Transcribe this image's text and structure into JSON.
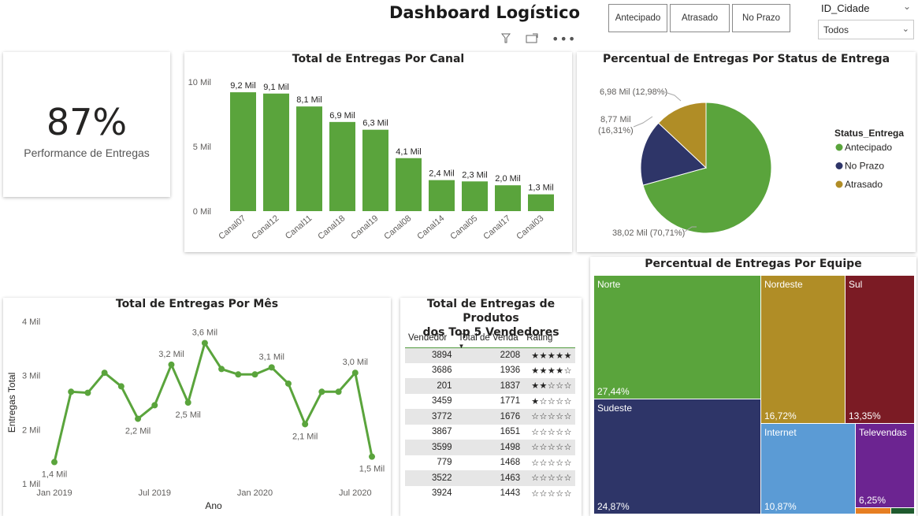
{
  "page": {
    "title": "Dashboard Logístico"
  },
  "filters": {
    "status_buttons": [
      "Antecipado",
      "Atrasado",
      "No Prazo"
    ],
    "id_cidade": {
      "label": "ID_Cidade",
      "value": "Todos"
    }
  },
  "toolbar": {
    "filter_icon": "filter-icon",
    "focus_icon": "focus-mode-icon",
    "more_icon": "more-options-icon"
  },
  "kpi": {
    "value": "87%",
    "label": "Performance de Entregas"
  },
  "colors": {
    "green": "#5aa43c",
    "navy": "#2e3568",
    "gold": "#b08d26",
    "maroon": "#7b1b24",
    "blue": "#5b9bd5",
    "purple": "#6c2491"
  },
  "chart_data": [
    {
      "type": "bar",
      "title": "Total de Entregas Por Canal",
      "categories": [
        "Canal07",
        "Canal12",
        "Canal11",
        "Canal18",
        "Canal19",
        "Canal08",
        "Canal14",
        "Canal05",
        "Canal17",
        "Canal03"
      ],
      "values": [
        9.2,
        9.1,
        8.1,
        6.9,
        6.3,
        4.1,
        2.4,
        2.3,
        2.0,
        1.3
      ],
      "data_labels": [
        "9,2 Mil",
        "9,1 Mil",
        "8,1 Mil",
        "6,9 Mil",
        "6,3 Mil",
        "4,1 Mil",
        "2,4 Mil",
        "2,3 Mil",
        "2,0 Mil",
        "1,3 Mil"
      ],
      "y_ticks": [
        "0 Mil",
        "5 Mil",
        "10 Mil"
      ],
      "ylim": [
        0,
        10
      ],
      "unit": "Mil"
    },
    {
      "type": "pie",
      "title": "Percentual de Entregas Por Status de Entrega",
      "legend_title": "Status_Entrega",
      "legend_position": "right",
      "slices": [
        {
          "name": "Antecipado",
          "value": 38.02,
          "label": "38,02 Mil (70,71%)",
          "color": "#5aa43c"
        },
        {
          "name": "No Prazo",
          "value": 8.77,
          "label_line1": "8,77 Mil",
          "label_line2": "(16,31%)",
          "color": "#2e3568"
        },
        {
          "name": "Atrasado",
          "value": 6.98,
          "label": "6,98 Mil (12,98%)",
          "color": "#b08d26"
        }
      ]
    },
    {
      "type": "line",
      "title": "Total de Entregas Por Mês",
      "xlabel": "Ano",
      "ylabel": "Entregas Total",
      "x_ticks": [
        "Jan 2019",
        "Jul 2019",
        "Jan 2020",
        "Jul 2020"
      ],
      "x_tick_index": [
        0,
        6,
        12,
        18
      ],
      "y_ticks": [
        "1 Mil",
        "2 Mil",
        "3 Mil",
        "4 Mil"
      ],
      "ylim": [
        1,
        4
      ],
      "values": [
        1.4,
        2.7,
        2.68,
        3.05,
        2.8,
        2.2,
        2.45,
        3.2,
        2.5,
        3.6,
        3.12,
        3.02,
        3.02,
        3.15,
        2.85,
        2.1,
        2.7,
        2.7,
        3.05,
        1.5
      ],
      "labeled_points": [
        {
          "i": 0,
          "text": "1,4 Mil",
          "pos": "below"
        },
        {
          "i": 5,
          "text": "2,2 Mil",
          "pos": "below"
        },
        {
          "i": 7,
          "text": "3,2 Mil",
          "pos": "above"
        },
        {
          "i": 8,
          "text": "2,5 Mil",
          "pos": "below"
        },
        {
          "i": 9,
          "text": "3,6 Mil",
          "pos": "above"
        },
        {
          "i": 13,
          "text": "3,1 Mil",
          "pos": "above"
        },
        {
          "i": 15,
          "text": "2,1 Mil",
          "pos": "below"
        },
        {
          "i": 18,
          "text": "3,0 Mil",
          "pos": "above"
        },
        {
          "i": 19,
          "text": "1,5 Mil",
          "pos": "below"
        }
      ]
    },
    {
      "type": "table",
      "title_line1": "Total de Entregas de Produtos",
      "title_line2": "dos Top 5 Vendedores",
      "columns": [
        "Vendedor",
        "Total de Venda",
        "Rating"
      ],
      "sort_column": "Total de Venda",
      "rows": [
        [
          "3894",
          "2208",
          "★★★★★"
        ],
        [
          "3686",
          "1936",
          "★★★★☆"
        ],
        [
          "201",
          "1837",
          "★★☆☆☆"
        ],
        [
          "3459",
          "1771",
          "★☆☆☆☆"
        ],
        [
          "3772",
          "1676",
          "☆☆☆☆☆"
        ],
        [
          "3867",
          "1651",
          "☆☆☆☆☆"
        ],
        [
          "3599",
          "1498",
          "☆☆☆☆☆"
        ],
        [
          "779",
          "1468",
          "☆☆☆☆☆"
        ],
        [
          "3522",
          "1463",
          "☆☆☆☆☆"
        ],
        [
          "3924",
          "1443",
          "☆☆☆☆☆"
        ]
      ]
    },
    {
      "type": "treemap",
      "title": "Percentual de Entregas Por Equipe",
      "items": [
        {
          "name": "Norte",
          "value": 27.44,
          "label": "27,44%",
          "color": "#5aa43c"
        },
        {
          "name": "Sudeste",
          "value": 24.87,
          "label": "24,87%",
          "color": "#2e3568"
        },
        {
          "name": "Nordeste",
          "value": 16.72,
          "label": "16,72%",
          "color": "#b08d26"
        },
        {
          "name": "Sul",
          "value": 13.35,
          "label": "13,35%",
          "color": "#7b1b24"
        },
        {
          "name": "Internet",
          "value": 10.87,
          "label": "10,87%",
          "color": "#5b9bd5"
        },
        {
          "name": "Televendas",
          "value": 6.25,
          "label": "6,25%",
          "color": "#6c2491"
        }
      ]
    }
  ]
}
